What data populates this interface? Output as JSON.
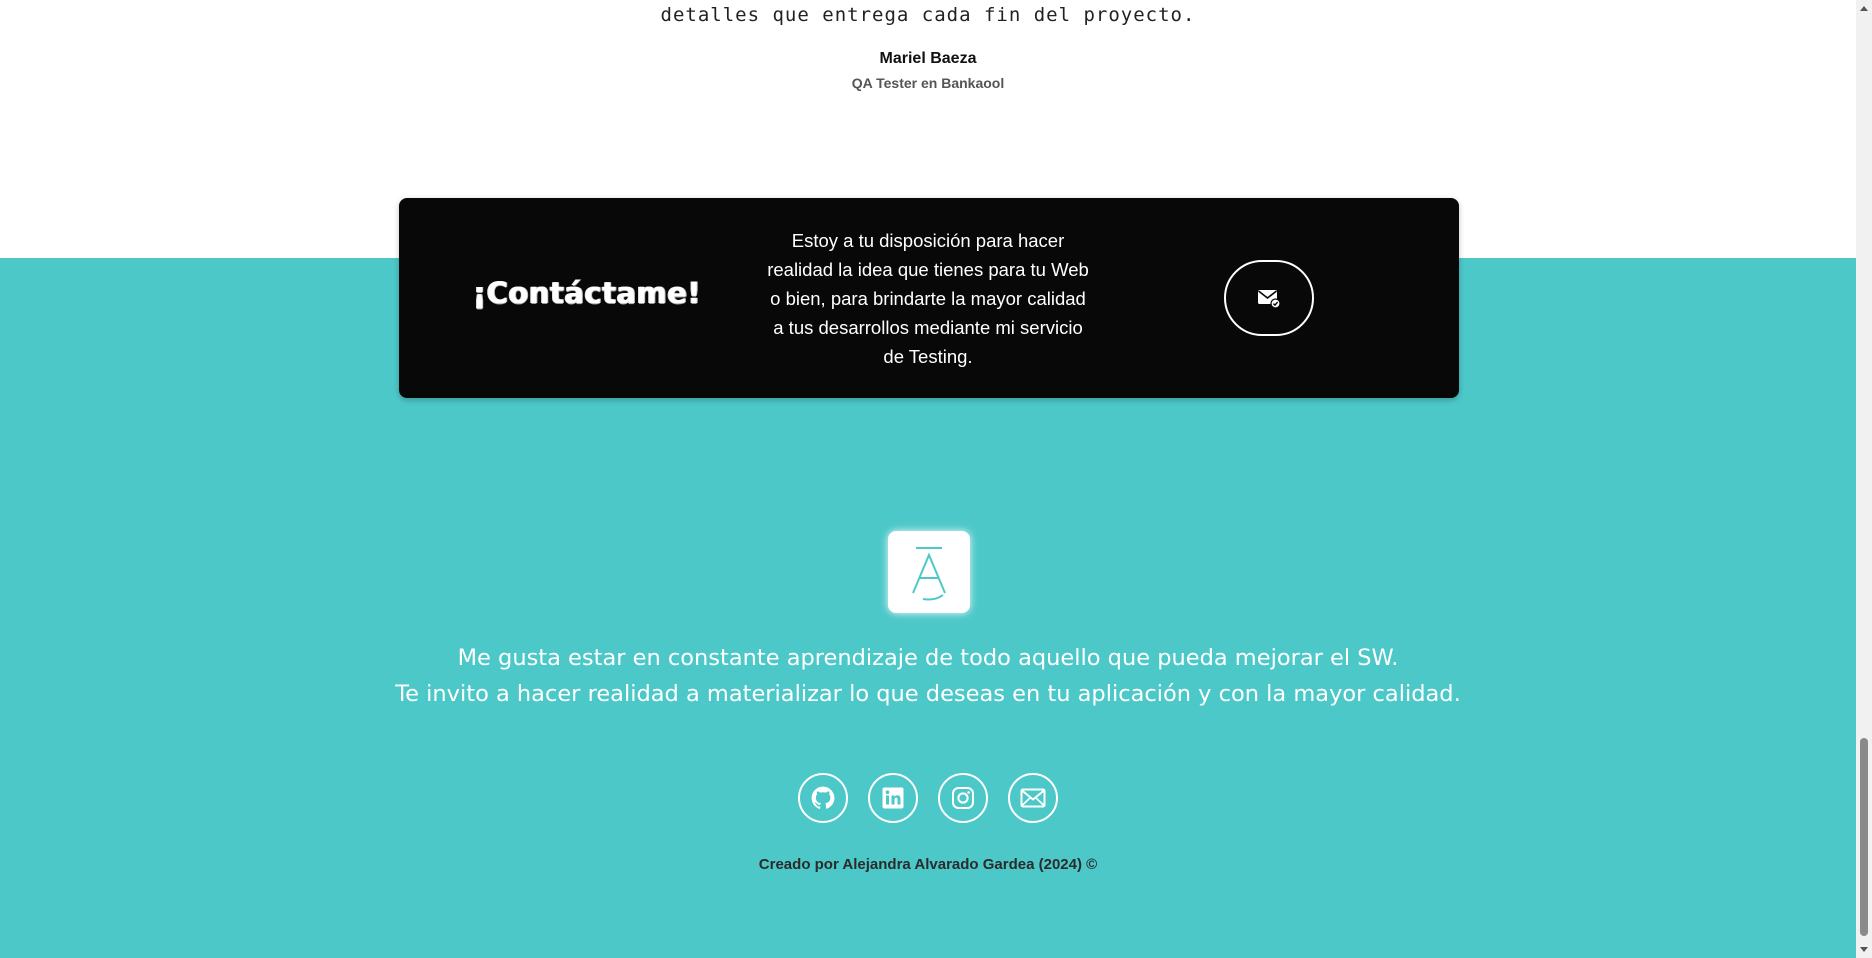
{
  "testimonial": {
    "quote_tail": "detalles que entrega cada fin del proyecto.",
    "author_name": "Mariel Baeza",
    "author_role": "QA Tester en Bankaool"
  },
  "contact": {
    "title": "¡Contáctame!",
    "text": "Estoy a tu disposición para hacer realidad la idea que tienes para tu Web o bien, para brindarte la mayor calidad a tus desarrollos mediante mi servicio de Testing.",
    "button_icon": "envelope-check-icon"
  },
  "footer": {
    "logo_letter": "Ā",
    "line1": "Me gusta estar en constante aprendizaje de todo aquello que pueda mejorar el SW.",
    "line2": "Te invito a hacer realidad a materializar lo que deseas en tu aplicación y con la mayor calidad.",
    "social": [
      "github-icon",
      "linkedin-icon",
      "instagram-icon",
      "mail-icon"
    ],
    "credit": "Creado por Alejandra Alvarado Gardea (2024) ©"
  },
  "colors": {
    "teal": "#4dc8c9",
    "card": "#080808",
    "white": "#ffffff"
  }
}
